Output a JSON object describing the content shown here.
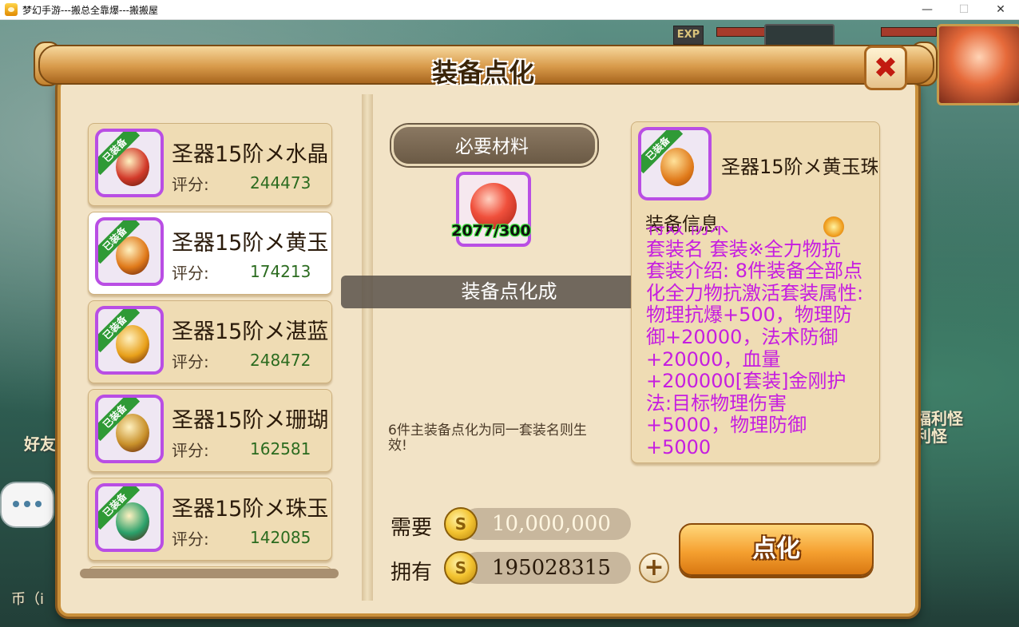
{
  "window": {
    "title": "梦幻手游---搬总全靠爆---搬搬屋",
    "controls": {
      "minimize": "—",
      "maximize": "☐",
      "close": "✕"
    }
  },
  "hud": {
    "exp_label": "EXP"
  },
  "background_text": {
    "left_friend": "好友",
    "left_currency": "币（i",
    "right_welfare": "福利怪",
    "right_welfare2": "利怪"
  },
  "dialog": {
    "title": "装备点化",
    "close_label": "✖"
  },
  "equipment_list": {
    "items": [
      {
        "name": "圣器15阶メ水晶",
        "score_label": "评分:",
        "score": "244473",
        "tag": "已装备",
        "selected": false,
        "gem_color": "#d23a2a"
      },
      {
        "name": "圣器15阶メ黄玉",
        "score_label": "评分:",
        "score": "174213",
        "tag": "已装备",
        "selected": true,
        "gem_color": "#e07a1a"
      },
      {
        "name": "圣器15阶メ湛蓝",
        "score_label": "评分:",
        "score": "248472",
        "tag": "已装备",
        "selected": false,
        "gem_color": "#e8a01a"
      },
      {
        "name": "圣器15阶メ珊瑚",
        "score_label": "评分:",
        "score": "162581",
        "tag": "已装备",
        "selected": false,
        "gem_color": "#c8902a"
      },
      {
        "name": "圣器15阶メ珠玉",
        "score_label": "评分:",
        "score": "142085",
        "tag": "已装备",
        "selected": false,
        "gem_color": "#2aa06a"
      }
    ]
  },
  "materials": {
    "label": "必要材料",
    "count": "2077/300"
  },
  "toast": "装备点化成",
  "note": "6件主装备点化为同一套装名则生效!",
  "cost": {
    "need_label": "需要",
    "need_value": "10,000,000",
    "have_label": "拥有",
    "have_value": "195028315",
    "coin_symbol": "S",
    "plus": "+"
  },
  "refine_button": "点化",
  "info": {
    "tag": "已装备",
    "name": "圣器15阶メ黄玉珠",
    "header": "装备信息",
    "lines": [
      "特效  防术",
      "套装名 套装※全力物抗",
      "套装介绍: 8件装备全部点化全力物抗激活套装属性:物理抗爆+500，物理防御+20000，法术防御+20000，血量+200000[套装]金刚护法:目标物理伤害+5000，物理防御+5000"
    ]
  },
  "colors": {
    "accent_purple": "#b94ee4",
    "info_text": "#c61ee0",
    "score_green": "#2b6b1f",
    "button_orange": "#f5a030"
  }
}
